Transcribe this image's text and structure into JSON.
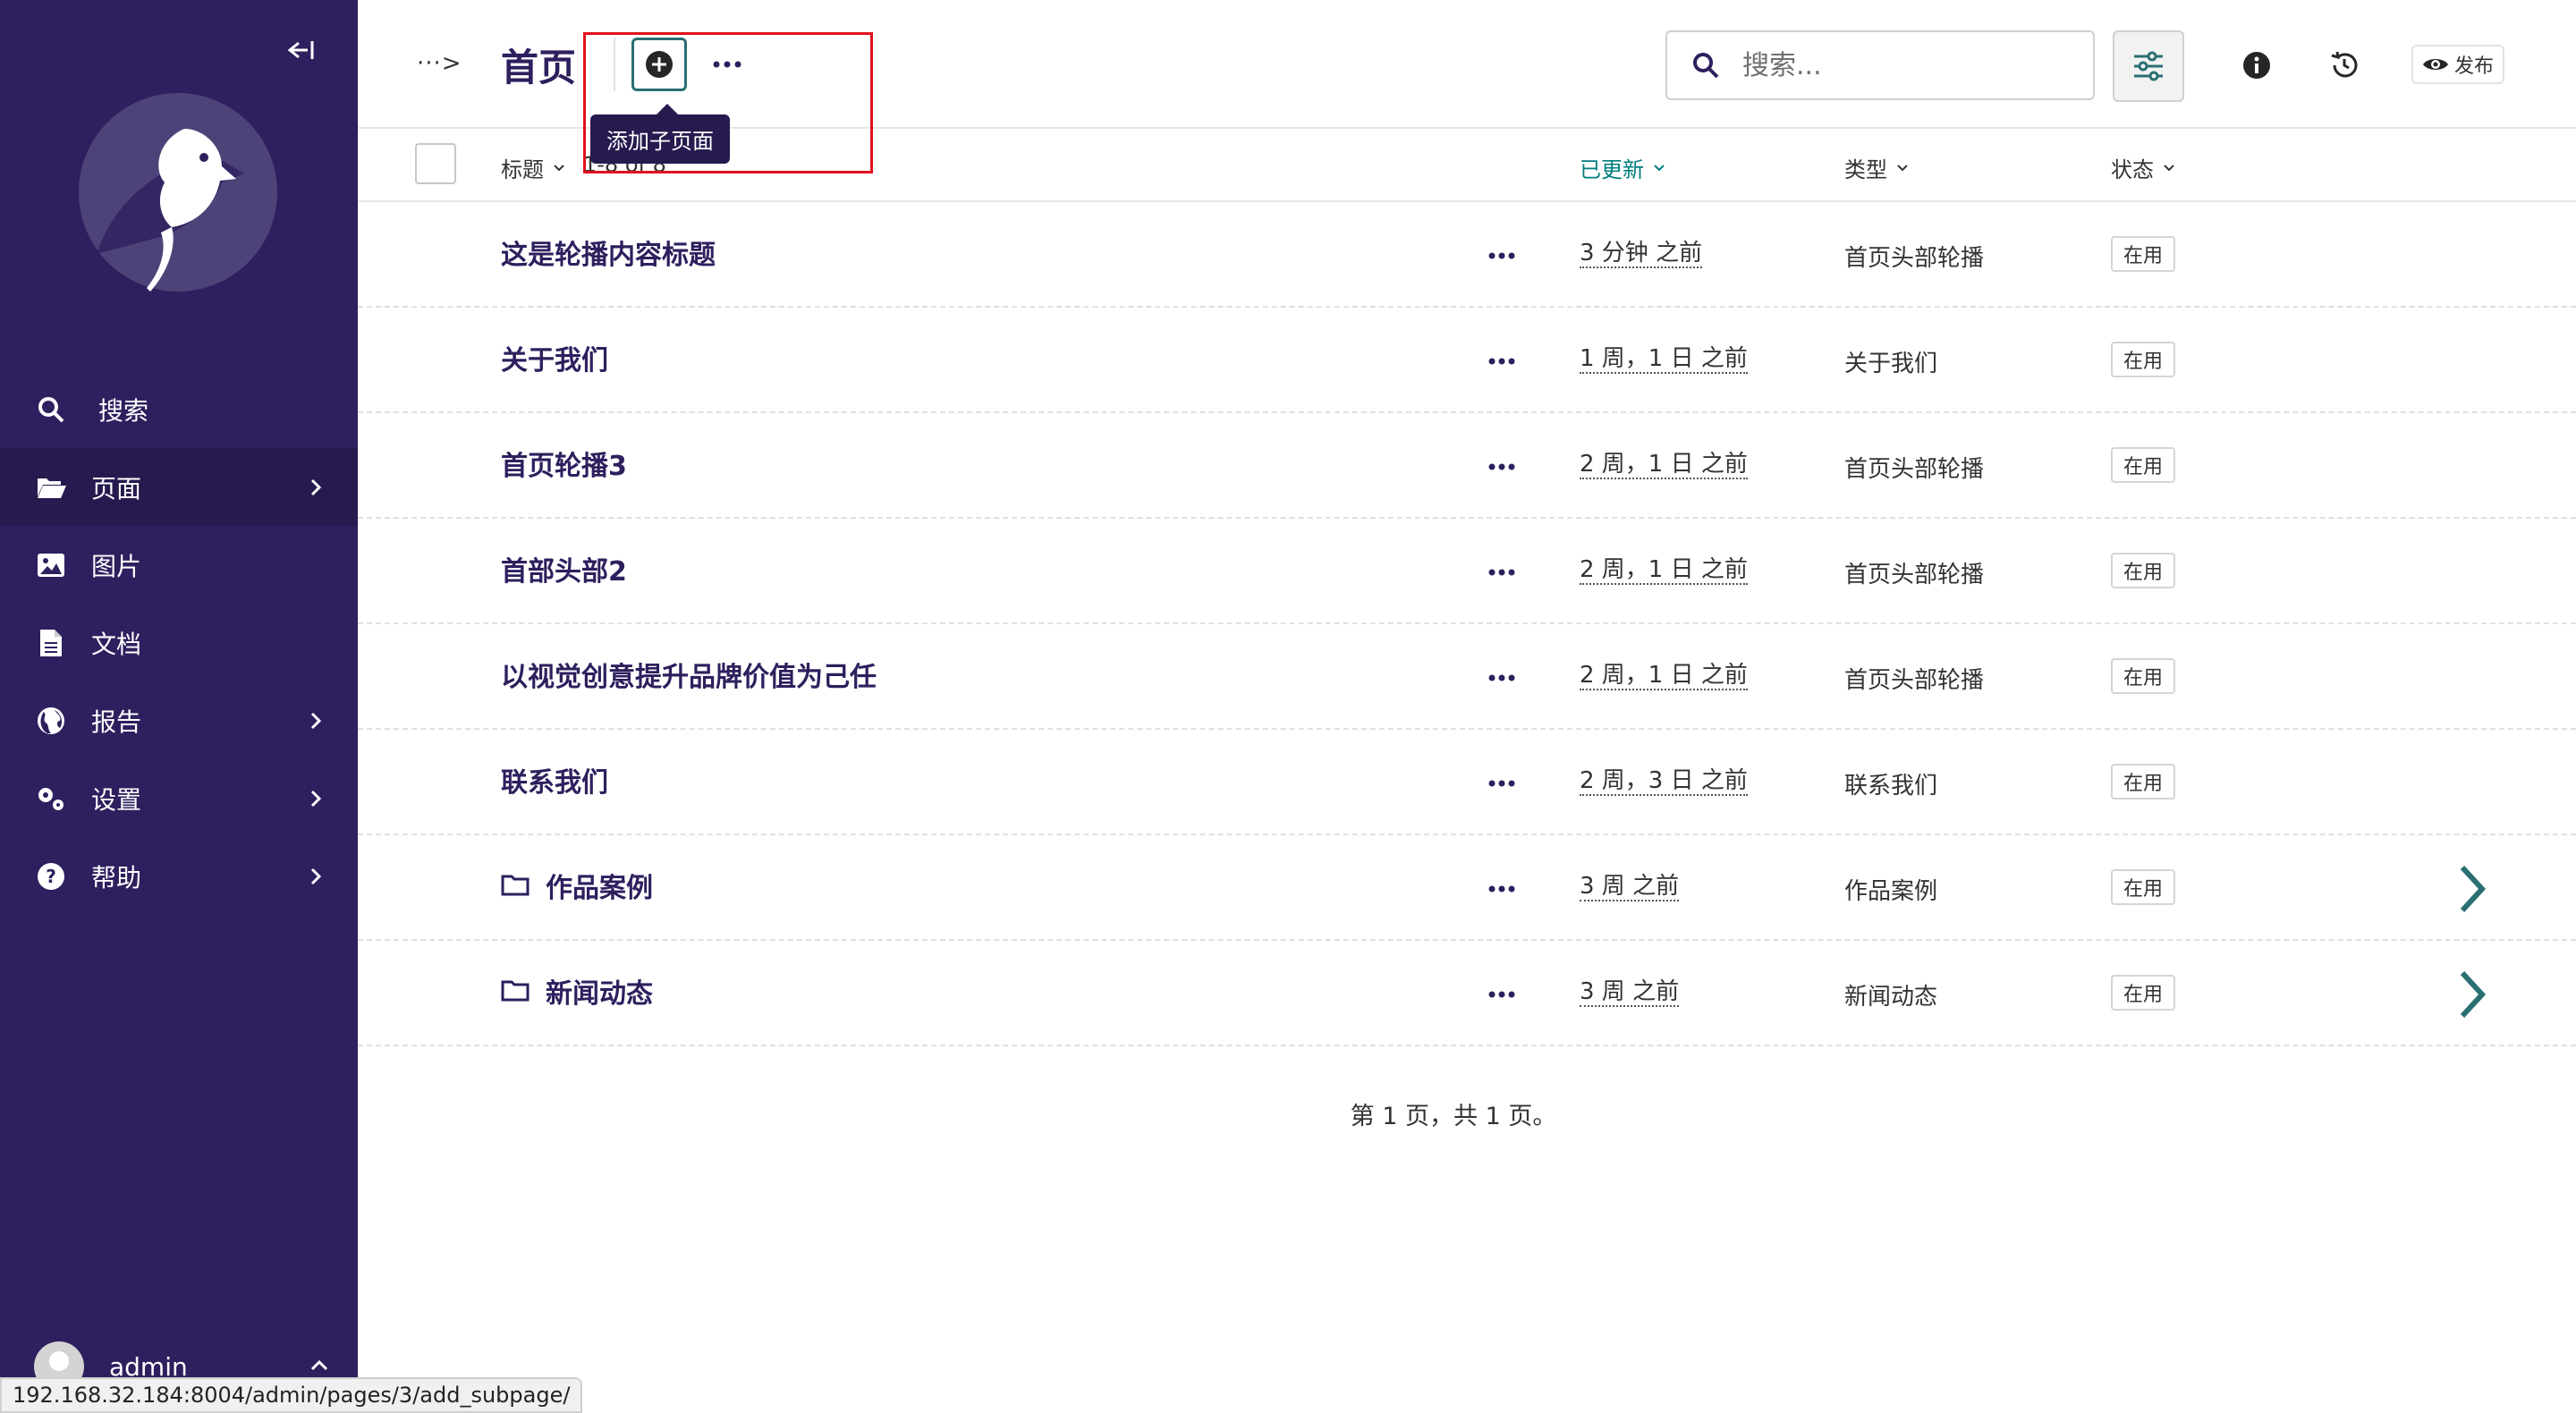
{
  "sidebar": {
    "collapse_label": "",
    "nav": [
      {
        "label": "搜索",
        "icon": "search-icon"
      },
      {
        "label": "页面",
        "icon": "folder-open-icon",
        "active": true,
        "has_children": true
      },
      {
        "label": "图片",
        "icon": "image-icon"
      },
      {
        "label": "文档",
        "icon": "document-icon"
      },
      {
        "label": "报告",
        "icon": "globe-icon",
        "has_children": true
      },
      {
        "label": "设置",
        "icon": "cogs-icon",
        "has_children": true
      },
      {
        "label": "帮助",
        "icon": "help-icon",
        "has_children": true
      }
    ],
    "account": {
      "name": "admin"
    }
  },
  "header": {
    "breadcrumb_toggle": "···>",
    "title": "首页",
    "add_child_tooltip": "添加子页面",
    "search_placeholder": "搜索...",
    "preview_label": "发布"
  },
  "table": {
    "columns": {
      "title": "标题",
      "count": "1-8 of 8",
      "updated": "已更新",
      "type": "类型",
      "status": "状态"
    },
    "rows": [
      {
        "title": "这是轮播内容标题",
        "updated": "3 分钟 之前",
        "type": "首页头部轮播",
        "status": "在用",
        "folder": false
      },
      {
        "title": "关于我们",
        "updated": "1 周，1 日 之前",
        "type": "关于我们",
        "status": "在用",
        "folder": false
      },
      {
        "title": "首页轮播3",
        "updated": "2 周，1 日 之前",
        "type": "首页头部轮播",
        "status": "在用",
        "folder": false
      },
      {
        "title": "首部头部2",
        "updated": "2 周，1 日 之前",
        "type": "首页头部轮播",
        "status": "在用",
        "folder": false
      },
      {
        "title": "以视觉创意提升品牌价值为己任",
        "updated": "2 周，1 日 之前",
        "type": "首页头部轮播",
        "status": "在用",
        "folder": false
      },
      {
        "title": "联系我们",
        "updated": "2 周，3 日 之前",
        "type": "联系我们",
        "status": "在用",
        "folder": false
      },
      {
        "title": "作品案例",
        "updated": "3 周 之前",
        "type": "作品案例",
        "status": "在用",
        "folder": true
      },
      {
        "title": "新闻动态",
        "updated": "3 周 之前",
        "type": "新闻动态",
        "status": "在用",
        "folder": true
      }
    ],
    "pagination": "第 1 页，共 1 页。"
  },
  "status_bar": {
    "url": "192.168.32.184:8004/admin/pages/3/add_subpage/"
  },
  "colors": {
    "sidebar_bg": "#2e1f5e",
    "accent_teal": "#007d7e",
    "highlight_red": "#e0121c"
  }
}
